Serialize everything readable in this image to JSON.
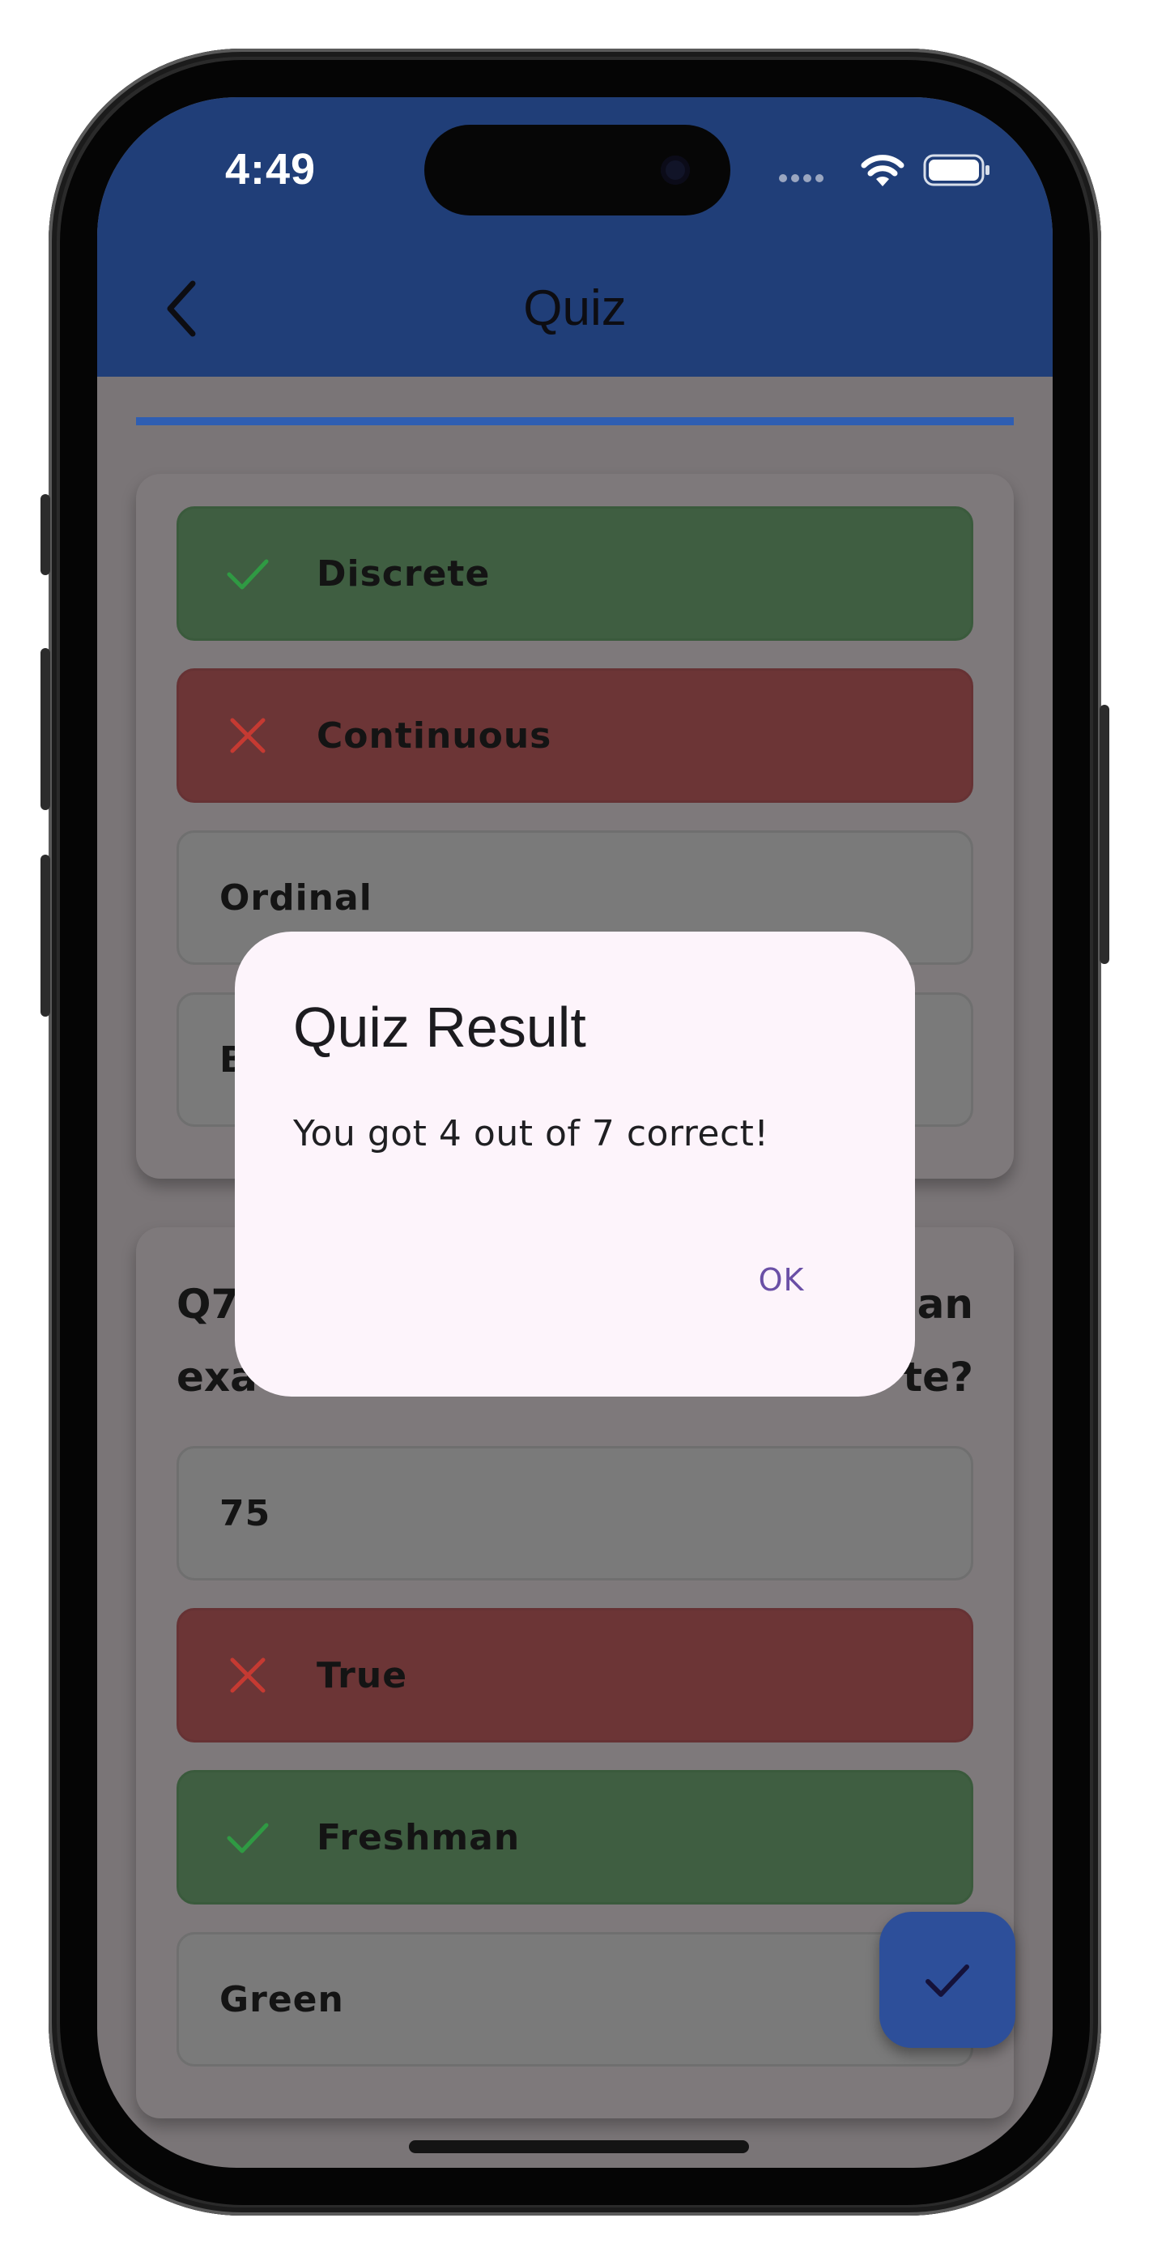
{
  "status_bar": {
    "time": "4:49"
  },
  "header": {
    "title": "Quiz"
  },
  "cards": [
    {
      "options": [
        {
          "label": "Discrete",
          "state": "correct"
        },
        {
          "label": "Continuous",
          "state": "wrong"
        },
        {
          "label": "Ordinal",
          "state": "neutral"
        },
        {
          "label": "B",
          "state": "neutral"
        }
      ]
    },
    {
      "question_line1": "Q7",
      "question_line1_end": "an",
      "question_line2": "exa",
      "question_line2_end": "te?",
      "options": [
        {
          "label": "75",
          "state": "neutral"
        },
        {
          "label": "True",
          "state": "wrong"
        },
        {
          "label": "Freshman",
          "state": "correct"
        },
        {
          "label": "Green",
          "state": "neutral"
        }
      ]
    }
  ],
  "dialog": {
    "title": "Quiz Result",
    "message": "You got 4 out of 7 correct!",
    "ok_label": "OK"
  },
  "colors": {
    "app_bar": "#203e78",
    "correct": "#3f5e41",
    "wrong": "#6c3536",
    "accent": "#6a4fa6"
  }
}
